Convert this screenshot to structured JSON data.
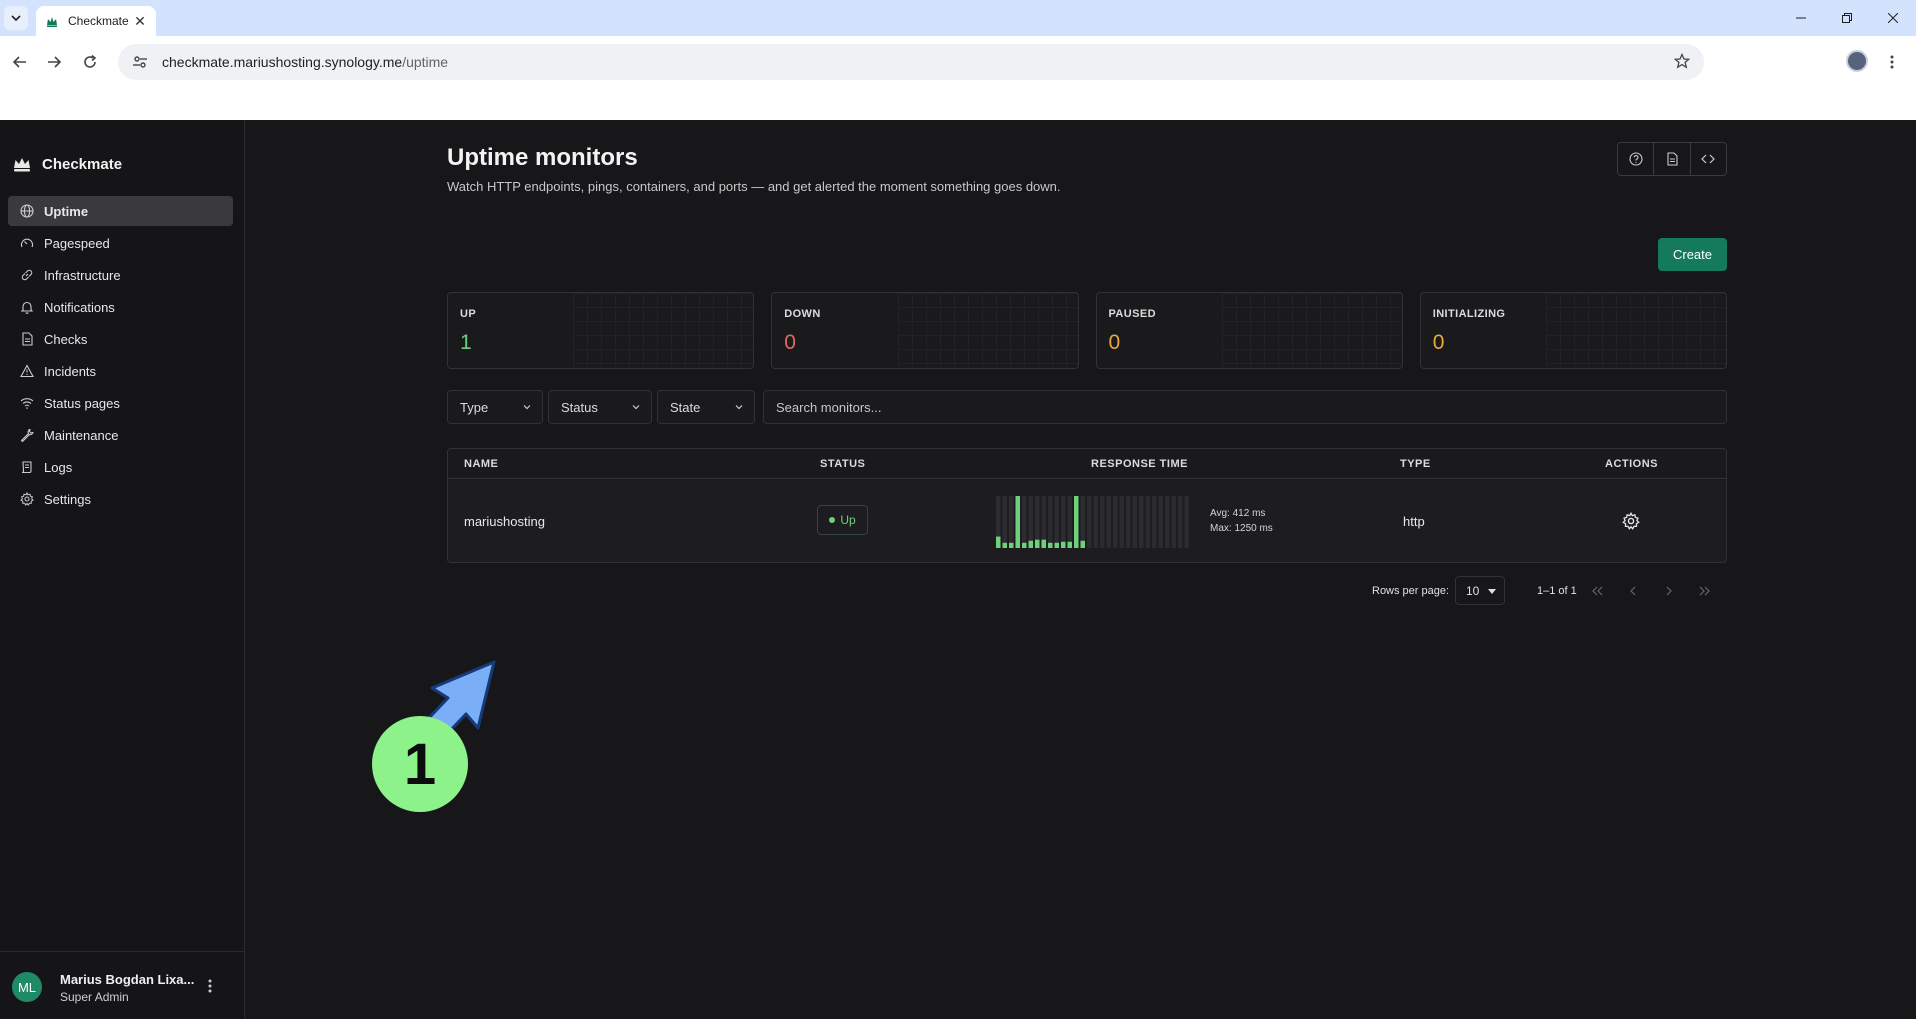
{
  "browser": {
    "tab_title": "Checkmate",
    "tab_close": "✕",
    "url_host": "checkmate.mariushosting.synology.me",
    "url_path": "/uptime"
  },
  "sidebar": {
    "brand": "Checkmate",
    "items": [
      {
        "label": "Uptime",
        "icon": "globe-icon",
        "active": true
      },
      {
        "label": "Pagespeed",
        "icon": "gauge-icon",
        "active": false
      },
      {
        "label": "Infrastructure",
        "icon": "link-icon",
        "active": false
      },
      {
        "label": "Notifications",
        "icon": "bell-icon",
        "active": false
      },
      {
        "label": "Checks",
        "icon": "file-icon",
        "active": false
      },
      {
        "label": "Incidents",
        "icon": "warning-icon",
        "active": false
      },
      {
        "label": "Status pages",
        "icon": "wifi-icon",
        "active": false
      },
      {
        "label": "Maintenance",
        "icon": "wrench-icon",
        "active": false
      },
      {
        "label": "Logs",
        "icon": "scroll-icon",
        "active": false
      },
      {
        "label": "Settings",
        "icon": "gear-icon",
        "active": false
      }
    ],
    "user": {
      "initials": "ML",
      "name": "Marius Bogdan Lixa...",
      "role": "Super Admin"
    }
  },
  "header": {
    "title": "Uptime monitors",
    "subtitle": "Watch HTTP endpoints, pings, containers, and ports — and get alerted the moment something goes down.",
    "create_label": "Create"
  },
  "stats": [
    {
      "label": "UP",
      "value": "1",
      "color": "#6fd07c"
    },
    {
      "label": "DOWN",
      "value": "0",
      "color": "#e2675f"
    },
    {
      "label": "PAUSED",
      "value": "0",
      "color": "#e8a83c"
    },
    {
      "label": "INITIALIZING",
      "value": "0",
      "color": "#e8a83c"
    }
  ],
  "filters": {
    "type": "Type",
    "status": "Status",
    "state": "State",
    "search_placeholder": "Search monitors..."
  },
  "table": {
    "columns": [
      "NAME",
      "STATUS",
      "RESPONSE TIME",
      "TYPE",
      "ACTIONS"
    ],
    "rows": [
      {
        "name": "mariushosting",
        "status": "Up",
        "avg": "Avg: 412 ms",
        "max": "Max: 1250 ms",
        "type": "http",
        "response_levels": [
          0.22,
          0.1,
          0.1,
          1.0,
          0.1,
          0.14,
          0.16,
          0.16,
          0.1,
          0.1,
          0.12,
          0.12,
          1.0,
          0.14,
          0,
          0,
          0,
          0,
          0,
          0,
          0,
          0,
          0,
          0,
          0,
          0,
          0,
          0,
          0,
          0
        ]
      }
    ]
  },
  "pagination": {
    "rows_label": "Rows per page:",
    "rows_value": "10",
    "range": "1–1 of 1"
  },
  "annotation": {
    "number": "1",
    "color": "#8ef28a",
    "arrow_color": "#7aaef7"
  },
  "colors": {
    "accent": "#157a5a",
    "bar_up": "#6fd07c",
    "bar_empty": "#2c2c30"
  }
}
